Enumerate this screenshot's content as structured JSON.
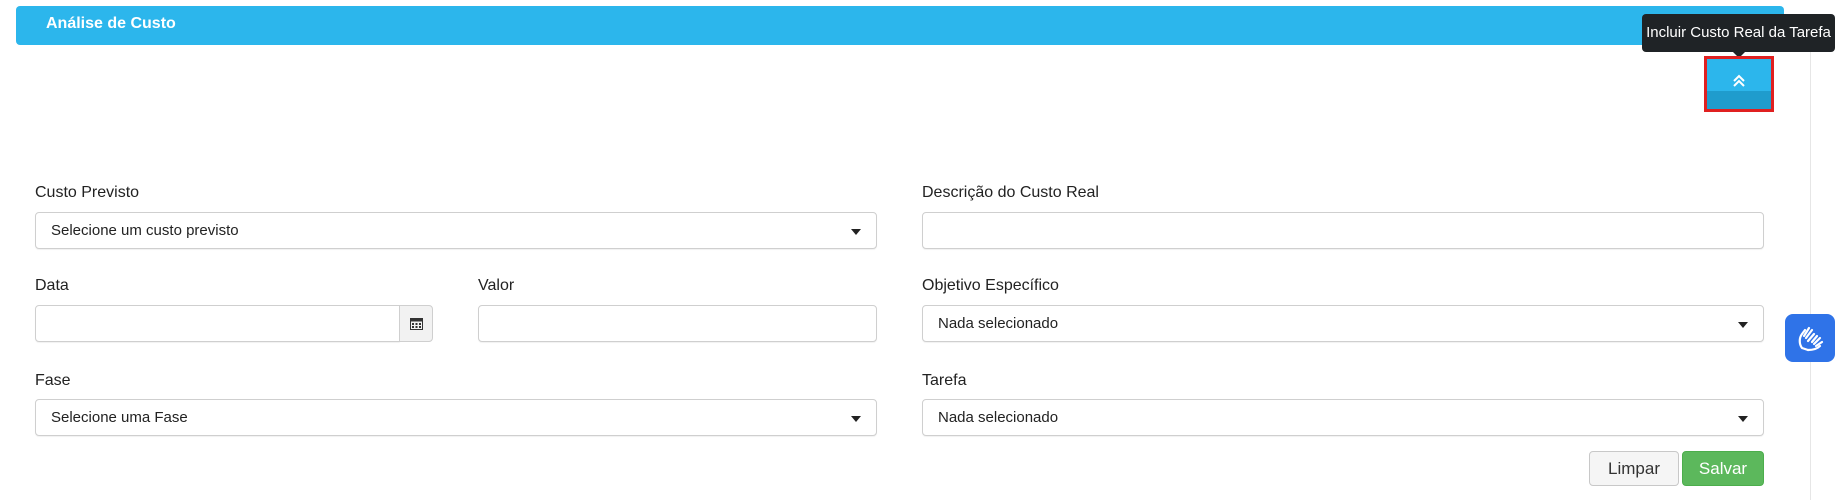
{
  "header": {
    "title": "Análise de Custo"
  },
  "tooltip": {
    "text": "Incluir Custo Real da Tarefa"
  },
  "icons": {
    "collapse": "double-chevron-up-icon",
    "calendar": "calendar-icon",
    "accessibility": "sign-language-hands-icon"
  },
  "colors": {
    "header": "#2cb6ec",
    "save_button": "#5cb85c",
    "accessibility_button": "#2f73e8",
    "highlight_border": "#e02020"
  },
  "form": {
    "custo_previsto": {
      "label": "Custo Previsto",
      "value": "Selecione um custo previsto"
    },
    "descricao": {
      "label": "Descrição do Custo Real",
      "value": ""
    },
    "data": {
      "label": "Data",
      "value": ""
    },
    "valor": {
      "label": "Valor",
      "value": ""
    },
    "objetivo": {
      "label": "Objetivo Específico",
      "value": "Nada selecionado"
    },
    "fase": {
      "label": "Fase",
      "value": "Selecione uma Fase"
    },
    "tarefa": {
      "label": "Tarefa",
      "value": "Nada selecionado"
    }
  },
  "actions": {
    "clear": "Limpar",
    "save": "Salvar"
  }
}
